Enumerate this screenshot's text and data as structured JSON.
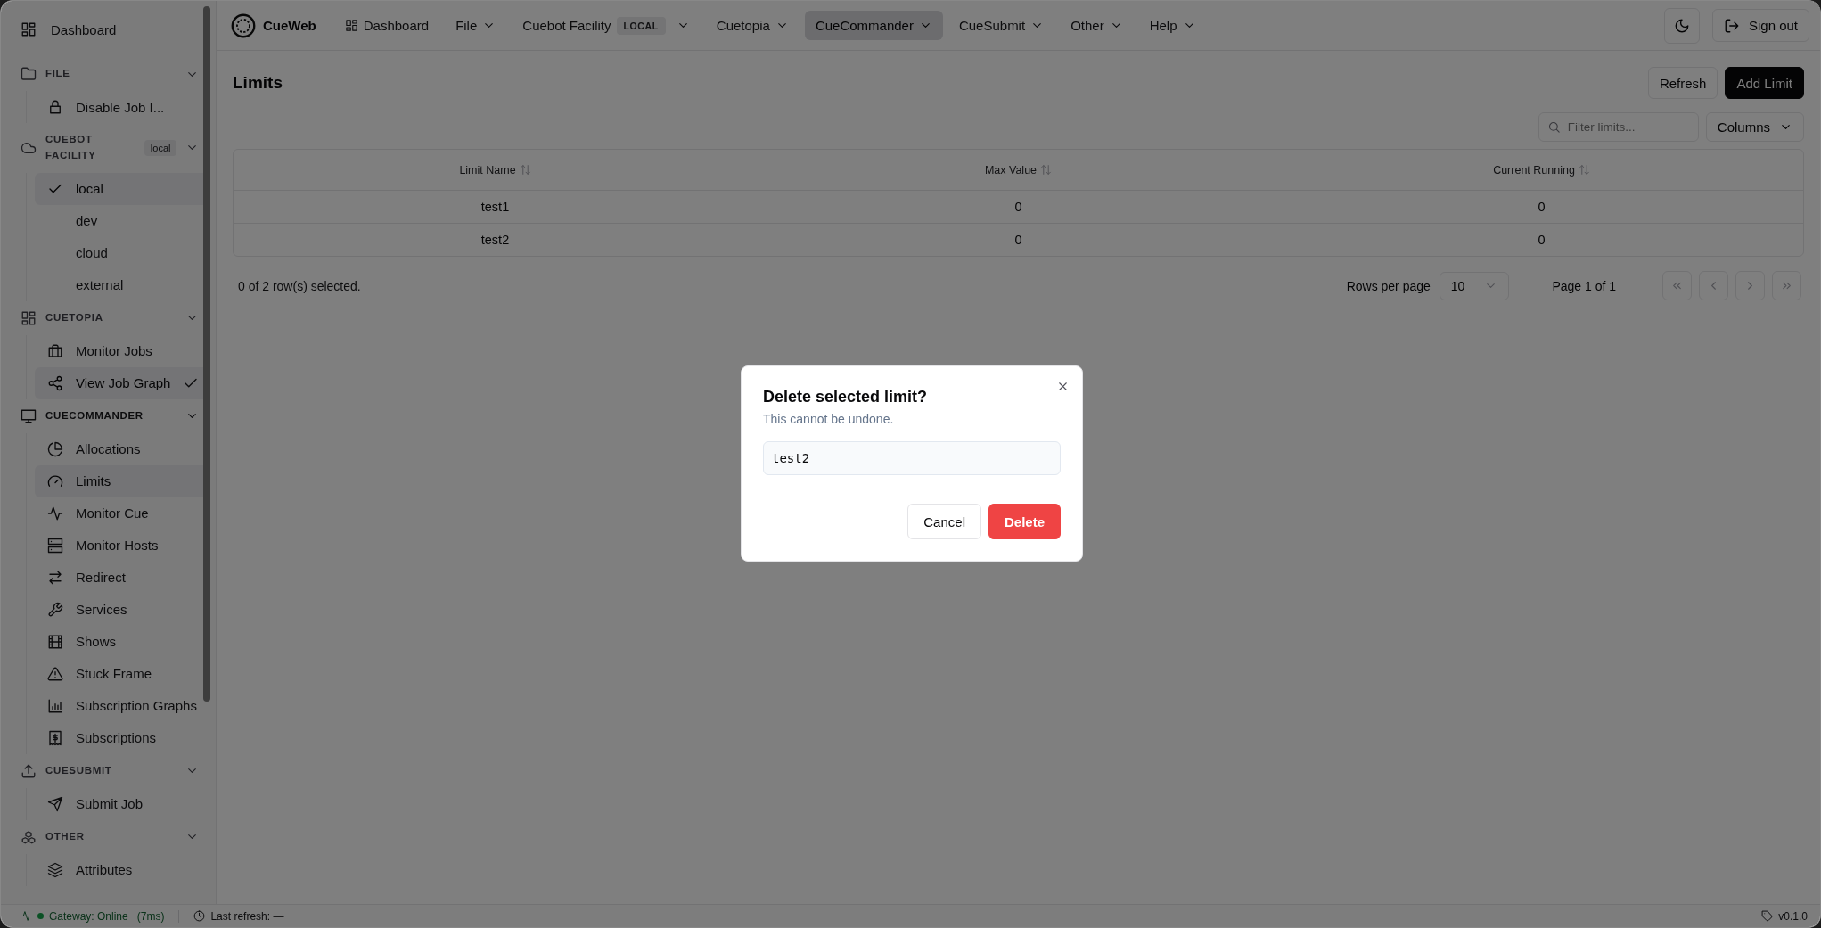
{
  "app": {
    "name": "CueWeb"
  },
  "nav": [
    {
      "label": "Dashboard",
      "kind": "link",
      "selected": false
    },
    {
      "label": "File",
      "kind": "menu",
      "selected": false
    },
    {
      "label": "Cuebot Facility",
      "kind": "menu",
      "badge": "LOCAL",
      "selected": false
    },
    {
      "label": "Cuetopia",
      "kind": "menu",
      "selected": false
    },
    {
      "label": "CueCommander",
      "kind": "menu",
      "selected": true
    },
    {
      "label": "CueSubmit",
      "kind": "menu",
      "selected": false
    },
    {
      "label": "Other",
      "kind": "menu",
      "selected": false
    },
    {
      "label": "Help",
      "kind": "menu",
      "selected": false
    }
  ],
  "header_actions": {
    "sign_out": "Sign out"
  },
  "sidebar": {
    "home": "Dashboard",
    "sections": [
      {
        "title": "FILE",
        "expanded": true,
        "active": false,
        "items": [
          {
            "label": "Disable Job I...",
            "kind": "link",
            "selected": false,
            "checked": false
          }
        ]
      },
      {
        "title": "CUEBOT FACILITY",
        "badge": "local",
        "expanded": true,
        "active": false,
        "items": [
          {
            "label": "local",
            "kind": "option",
            "selected": true,
            "checked": true
          },
          {
            "label": "dev",
            "kind": "option",
            "selected": false,
            "checked": false
          },
          {
            "label": "cloud",
            "kind": "option",
            "selected": false,
            "checked": false
          },
          {
            "label": "external",
            "kind": "option",
            "selected": false,
            "checked": false
          }
        ]
      },
      {
        "title": "CUETOPIA",
        "expanded": true,
        "active": false,
        "items": [
          {
            "label": "Monitor Jobs",
            "kind": "link",
            "selected": false,
            "checked": false
          },
          {
            "label": "View Job Graph",
            "kind": "link",
            "selected": true,
            "checked": true
          }
        ]
      },
      {
        "title": "CUECOMMANDER",
        "expanded": true,
        "active": true,
        "items": [
          {
            "label": "Allocations",
            "kind": "link",
            "selected": false,
            "checked": false
          },
          {
            "label": "Limits",
            "kind": "link",
            "selected": true,
            "checked": false
          },
          {
            "label": "Monitor Cue",
            "kind": "link",
            "selected": false,
            "checked": false
          },
          {
            "label": "Monitor Hosts",
            "kind": "link",
            "selected": false,
            "checked": false
          },
          {
            "label": "Redirect",
            "kind": "link",
            "selected": false,
            "checked": false
          },
          {
            "label": "Services",
            "kind": "link",
            "selected": false,
            "checked": false
          },
          {
            "label": "Shows",
            "kind": "link",
            "selected": false,
            "checked": false
          },
          {
            "label": "Stuck Frame",
            "kind": "link",
            "selected": false,
            "checked": false
          },
          {
            "label": "Subscription Graphs",
            "kind": "link",
            "selected": false,
            "checked": false
          },
          {
            "label": "Subscriptions",
            "kind": "link",
            "selected": false,
            "checked": false
          }
        ]
      },
      {
        "title": "CUESUBMIT",
        "expanded": true,
        "active": false,
        "items": [
          {
            "label": "Submit Job",
            "kind": "link",
            "selected": false,
            "checked": false
          }
        ]
      },
      {
        "title": "OTHER",
        "expanded": true,
        "active": false,
        "items": [
          {
            "label": "Attributes",
            "kind": "link",
            "selected": false,
            "checked": false
          }
        ]
      }
    ]
  },
  "page": {
    "title": "Limits",
    "actions": [
      {
        "label": "Refresh",
        "kind": "outline"
      },
      {
        "label": "Add Limit",
        "kind": "primary"
      }
    ],
    "filter": {
      "placeholder": "Filter limits..."
    },
    "columns_button": "Columns",
    "table": {
      "columns": [
        "Limit Name",
        "Max Value",
        "Current Running"
      ],
      "rows": [
        {
          "cells": [
            "test1",
            "0",
            "0"
          ],
          "selected": false
        },
        {
          "cells": [
            "test2",
            "0",
            "0"
          ],
          "selected": false
        }
      ]
    },
    "footer": {
      "selection": "0 of 2 row(s) selected.",
      "rows_per_page_label": "Rows per page",
      "rows_per_page": "10",
      "page": "Page 1 of 1"
    }
  },
  "dialog": {
    "title": "Delete selected limit?",
    "description": "This cannot be undone.",
    "value": "test2",
    "buttons": [
      {
        "label": "Cancel",
        "kind": "secondary"
      },
      {
        "label": "Delete",
        "kind": "destructive"
      }
    ]
  },
  "status_bar": {
    "gateway": "Gateway: Online",
    "latency": "(7ms)",
    "online": true,
    "last_refresh": "Last refresh: —",
    "version": "v0.1.0"
  }
}
